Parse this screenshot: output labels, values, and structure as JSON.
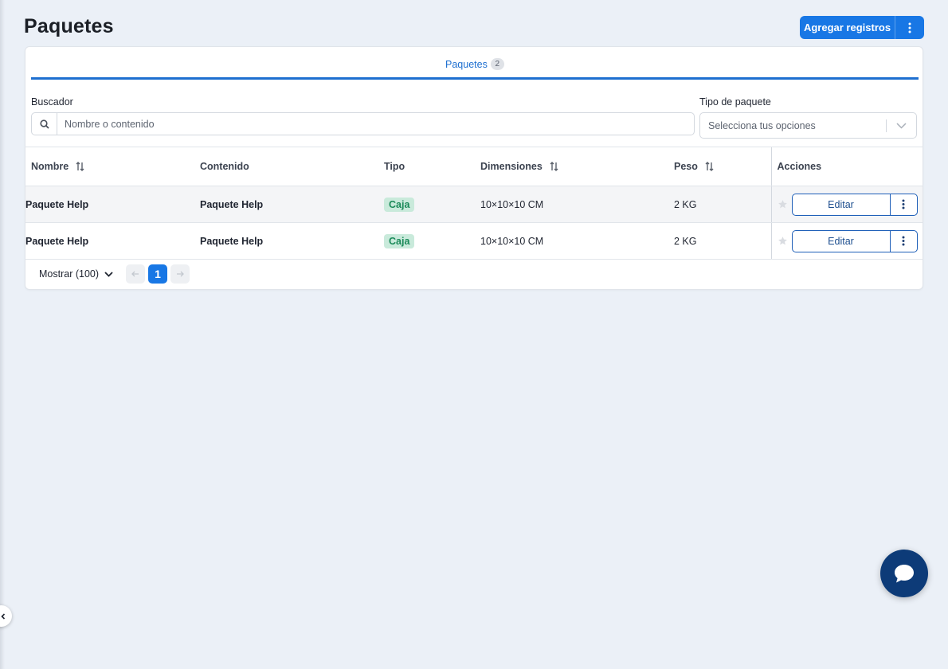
{
  "page": {
    "title": "Paquetes"
  },
  "header_actions": {
    "add_label": "Agregar registros",
    "more_icon": "kebab-vertical-icon"
  },
  "tabs": [
    {
      "label": "Paquetes",
      "count": "2",
      "active": true
    }
  ],
  "filters": {
    "search_label": "Buscador",
    "search_placeholder": "Nombre o contenido",
    "search_value": "",
    "type_label": "Tipo de paquete",
    "type_placeholder": "Selecciona tus opciones"
  },
  "table": {
    "columns": {
      "nombre": "Nombre",
      "contenido": "Contenido",
      "tipo": "Tipo",
      "dimensiones": "Dimensiones",
      "peso": "Peso",
      "acciones": "Acciones"
    },
    "rows": [
      {
        "nombre": "Paquete Help",
        "contenido": "Paquete Help",
        "tipo": "Caja",
        "dimensiones": "10×10×10 CM",
        "peso": "2 KG",
        "edit_label": "Editar"
      },
      {
        "nombre": "Paquete Help",
        "contenido": "Paquete Help",
        "tipo": "Caja",
        "dimensiones": "10×10×10 CM",
        "peso": "2 KG",
        "edit_label": "Editar"
      }
    ]
  },
  "pagination": {
    "show_label": "Mostrar (100)",
    "current_page": "1"
  },
  "colors": {
    "primary": "#1877e5",
    "background": "#ebf0f7",
    "badge_bg": "#c9eadb",
    "badge_text": "#1b8a59",
    "chat_bg": "#0d3b78"
  }
}
